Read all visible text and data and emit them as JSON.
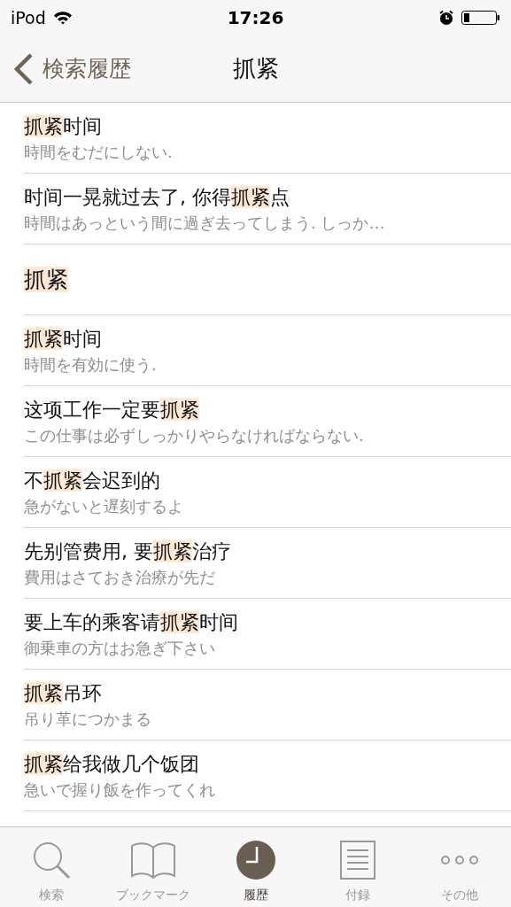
{
  "status_bar": {
    "carrier": "iPod",
    "time": "17:26"
  },
  "nav": {
    "back": "検索履歴",
    "title": "抓紧"
  },
  "entries": [
    {
      "kind": "example",
      "text": [
        {
          "text": "抓紧",
          "highlight": true
        },
        {
          "text": "时间",
          "highlight": false
        }
      ],
      "translation": "時間をむだにしない."
    },
    {
      "kind": "example",
      "text": [
        {
          "text": "时间一晃就过去了, 你得",
          "highlight": false
        },
        {
          "text": "抓紧",
          "highlight": true
        },
        {
          "text": "点",
          "highlight": false
        }
      ],
      "translation": "時間はあっという間に過ぎ去ってしまう. しっか…"
    },
    {
      "kind": "headword",
      "text": [
        {
          "text": "抓紧",
          "highlight": true
        }
      ]
    },
    {
      "kind": "example",
      "text": [
        {
          "text": "抓紧",
          "highlight": true
        },
        {
          "text": "时间",
          "highlight": false
        }
      ],
      "translation": "時間を有効に使う."
    },
    {
      "kind": "example",
      "text": [
        {
          "text": "这项工作一定要",
          "highlight": false
        },
        {
          "text": "抓紧",
          "highlight": true
        }
      ],
      "translation": "この仕事は必ずしっかりやらなければならない."
    },
    {
      "kind": "example",
      "text": [
        {
          "text": "不",
          "highlight": false
        },
        {
          "text": "抓紧",
          "highlight": true
        },
        {
          "text": "会迟到的",
          "highlight": false
        }
      ],
      "translation": "急がないと遅刻するよ"
    },
    {
      "kind": "example",
      "text": [
        {
          "text": "先别管费用, 要",
          "highlight": false
        },
        {
          "text": "抓紧",
          "highlight": true
        },
        {
          "text": "治疗",
          "highlight": false
        }
      ],
      "translation": "費用はさておき治療が先だ"
    },
    {
      "kind": "example",
      "text": [
        {
          "text": "要上车的乘客请",
          "highlight": false
        },
        {
          "text": "抓紧",
          "highlight": true
        },
        {
          "text": "时间",
          "highlight": false
        }
      ],
      "translation": "御乗車の方はお急ぎ下さい"
    },
    {
      "kind": "example",
      "text": [
        {
          "text": "抓紧",
          "highlight": true
        },
        {
          "text": "吊环",
          "highlight": false
        }
      ],
      "translation": "吊り革につかまる"
    },
    {
      "kind": "example",
      "text": [
        {
          "text": "抓紧",
          "highlight": true
        },
        {
          "text": "给我做几个饭团",
          "highlight": false
        }
      ],
      "translation": "急いで握り飯を作ってくれ"
    }
  ],
  "tabs": [
    {
      "label": "検索",
      "selected": false
    },
    {
      "label": "ブックマーク",
      "selected": false
    },
    {
      "label": "履歴",
      "selected": true
    },
    {
      "label": "付録",
      "selected": false
    },
    {
      "label": "その他",
      "selected": false
    }
  ]
}
